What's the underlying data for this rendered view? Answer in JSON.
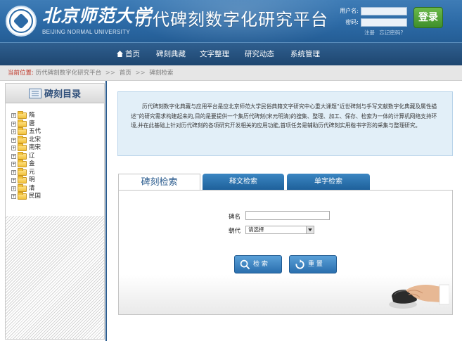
{
  "header": {
    "university_cn": "北京师范大学",
    "university_en": "BEIJING NORMAL UNIVERSITY",
    "site_title": "历代碑刻数字化研究平台",
    "username_label": "用户名:",
    "password_label": "密码:",
    "login_button": "登录",
    "register_link": "注册",
    "forgot_link": "忘记密码?"
  },
  "nav": {
    "items": [
      "首页",
      "碑刻典藏",
      "文字整理",
      "研究动态",
      "系统管理"
    ]
  },
  "breadcrumb": {
    "current_label": "当前位置:",
    "site": "历代碑刻数字化研究平台",
    "home": "首页",
    "page": "碑刻检索",
    "separator": ">>"
  },
  "sidebar": {
    "title": "碑刻目录",
    "items": [
      "隋",
      "唐",
      "五代",
      "北宋",
      "南宋",
      "辽",
      "金",
      "元",
      "明",
      "清",
      "民国"
    ]
  },
  "intro": {
    "text": "历代碑刻数字化典藏与应用平台是应北京师范大学民俗典籍文字研究中心重大课题“近世碑刻与手写文献数字化典藏及属性描述”的研究需求构建起来的,目的是要提供一个集历代碑刻(宋元明清)的搜集、整理、加工、保存、检索为一体的计算机网络支持环境,并在此基础上针对历代碑刻的各项研究开发相关的应用功能,首项任务是辅助历代碑刻实用楷书字形的采集与整理研究。"
  },
  "tabs": [
    "碑刻检索",
    "释文检索",
    "单字检索"
  ],
  "search": {
    "name_label": "碑名",
    "name_value": "",
    "dynasty_label": "朝代",
    "dynasty_selected": "请选择",
    "search_button": "检 索",
    "reset_button": "重 置"
  },
  "colors": {
    "header_blue": "#2c6aa6",
    "nav_blue": "#1e4670",
    "login_green": "#3f8f2b",
    "breadcrumb_red": "#c0392b",
    "intro_bg": "#e2eff8"
  }
}
